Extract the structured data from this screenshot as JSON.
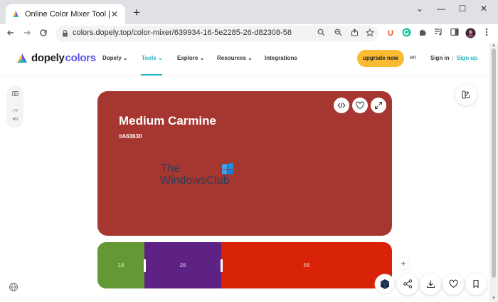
{
  "browser": {
    "tab_title": "Online Color Mixer Tool | Dopely",
    "tab_close": "✕",
    "new_tab": "+",
    "window_minimize": "⌄",
    "window_min2": "—",
    "window_max": "☐",
    "window_close": "✕",
    "url": "colors.dopely.top/color-mixer/639934-16-5e2285-26-d82308-58",
    "ext_u_label": "U"
  },
  "site": {
    "logo_part1": "dopely",
    "logo_part2": "colors",
    "nav": [
      {
        "label": "Dopely"
      },
      {
        "label": "Tools"
      },
      {
        "label": "Explore"
      },
      {
        "label": "Resources"
      },
      {
        "label": "Integrations"
      }
    ],
    "upgrade_label": "upgrade now",
    "lang": "en",
    "sign_in": "Sign in",
    "separator": "|",
    "sign_up": "Sign up"
  },
  "color": {
    "name": "Medium Carmine",
    "hex": "#A63630"
  },
  "watermark": {
    "line1": "The",
    "line2": "WindowsClub"
  },
  "mix": {
    "segments": [
      {
        "percent": "16",
        "color": "#639934",
        "share": 16
      },
      {
        "percent": "26",
        "color": "#5e2285",
        "share": 26
      },
      {
        "percent": "58",
        "color": "#d82308",
        "share": 58
      }
    ],
    "add_label": "+"
  },
  "colors": {
    "accent": "#23b3c4",
    "upgrade": "#f9bb32",
    "brand": "#5a55e6"
  }
}
